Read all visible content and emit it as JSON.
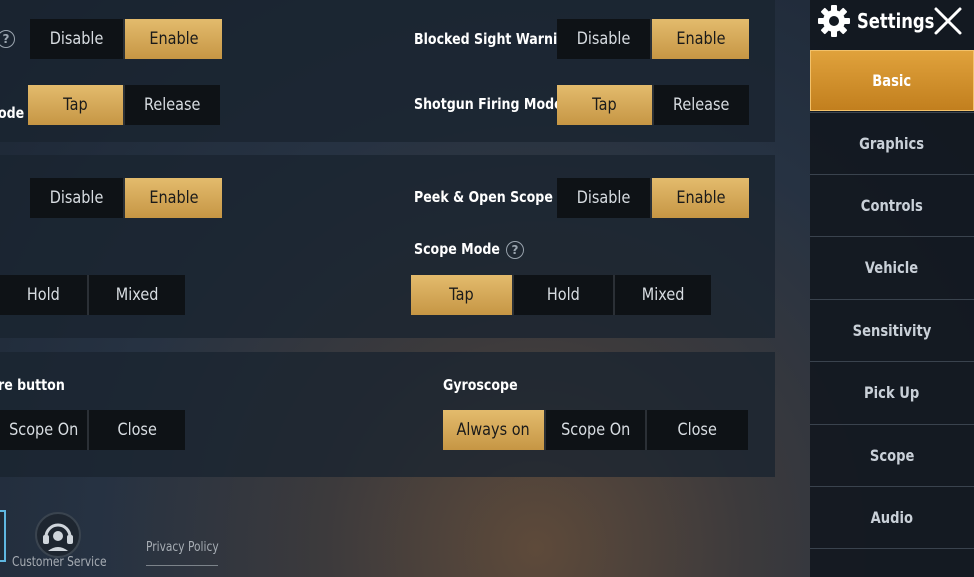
{
  "header": {
    "title": "Settings"
  },
  "sidebar": {
    "items": [
      {
        "label": "Basic"
      },
      {
        "label": "Graphics"
      },
      {
        "label": "Controls"
      },
      {
        "label": "Vehicle"
      },
      {
        "label": "Sensitivity"
      },
      {
        "label": "Pick Up"
      },
      {
        "label": "Scope"
      },
      {
        "label": "Audio"
      }
    ],
    "active": "Basic"
  },
  "section1": {
    "left_toggle": {
      "options": [
        "Disable",
        "Enable"
      ],
      "selected": "Enable"
    },
    "left_mode_label_fragment": "ode",
    "left_mode": {
      "options": [
        "Tap",
        "Release"
      ],
      "selected": "Tap"
    },
    "blocked_sight": {
      "label": "Blocked Sight Warning",
      "options": [
        "Disable",
        "Enable"
      ],
      "selected": "Enable"
    },
    "shotgun": {
      "label": "Shotgun Firing Mode",
      "options": [
        "Tap",
        "Release"
      ],
      "selected": "Tap"
    }
  },
  "section2": {
    "left_toggle": {
      "options": [
        "Disable",
        "Enable"
      ],
      "selected": "Enable"
    },
    "left_mode": {
      "options": [
        "Hold",
        "Mixed"
      ]
    },
    "peek": {
      "label": "Peek & Open Scope",
      "options": [
        "Disable",
        "Enable"
      ],
      "selected": "Enable"
    },
    "scope_mode": {
      "label": "Scope Mode",
      "options": [
        "Tap",
        "Hold",
        "Mixed"
      ],
      "selected": "Tap"
    }
  },
  "section3": {
    "left_label_fragment": "re button",
    "left_mode": {
      "options": [
        "Scope On",
        "Close"
      ]
    },
    "gyroscope": {
      "label": "Gyroscope",
      "options": [
        "Always on",
        "Scope On",
        "Close"
      ],
      "selected": "Always on"
    }
  },
  "footer": {
    "customer_service": "Customer Service",
    "privacy_policy": "Privacy Policy"
  },
  "colors": {
    "accent": "#d4a655",
    "sidebar_active": "#d8952f",
    "option_bg": "#0e1216"
  }
}
